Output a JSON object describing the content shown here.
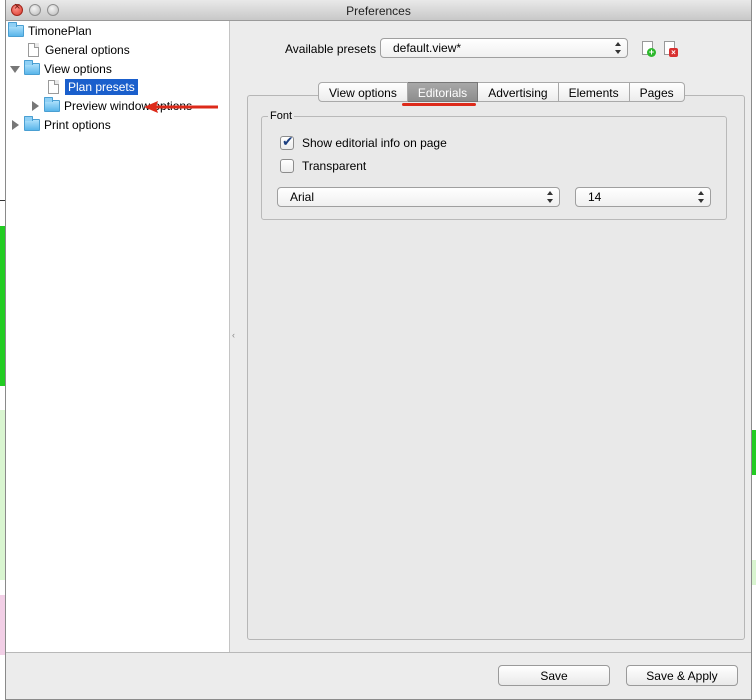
{
  "window": {
    "title": "Preferences"
  },
  "tree": {
    "items": [
      {
        "label": "TimonePlan"
      },
      {
        "label": "General options"
      },
      {
        "label": "View options"
      },
      {
        "label": "Plan presets"
      },
      {
        "label": "Preview window options"
      },
      {
        "label": "Print options"
      }
    ]
  },
  "presets": {
    "label": "Available presets",
    "selected": "default.view*"
  },
  "tabs": [
    {
      "label": "View options"
    },
    {
      "label": "Editorials"
    },
    {
      "label": "Advertising"
    },
    {
      "label": "Elements"
    },
    {
      "label": "Pages"
    }
  ],
  "font_group": {
    "title": "Font",
    "show_editorial_label": "Show editorial info on page",
    "transparent_label": "Transparent",
    "font_family": "Arial",
    "font_size": "14"
  },
  "buttons": {
    "save": "Save",
    "save_apply": "Save & Apply"
  },
  "colors": {
    "selection": "#1a5fcc",
    "annotation": "#dd2a1a"
  }
}
